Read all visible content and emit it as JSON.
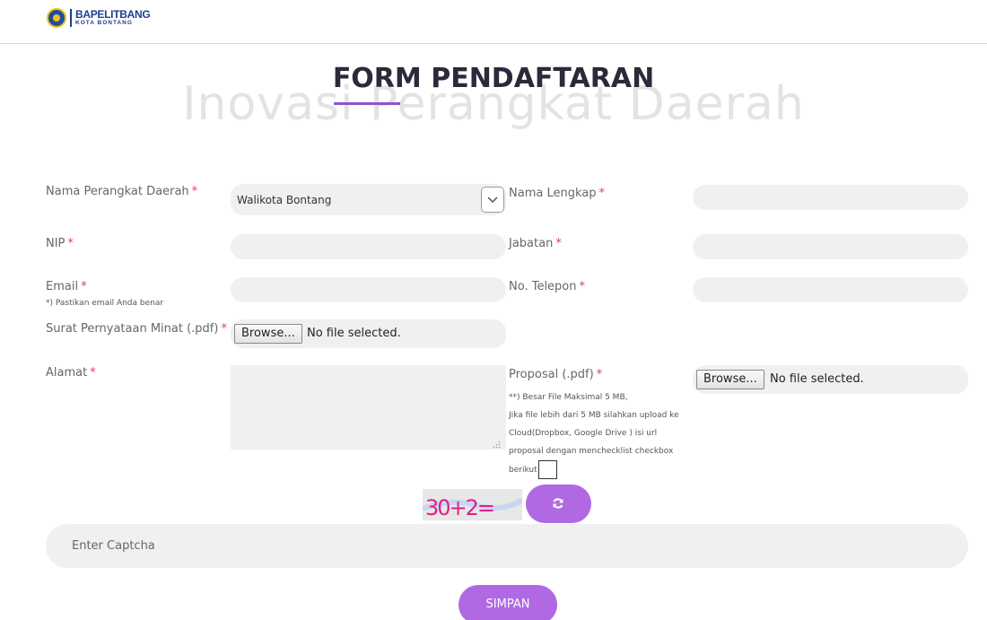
{
  "header": {
    "logo_title": "BAPELITBANG",
    "logo_subtitle": "KOTA BONTANG"
  },
  "page": {
    "title": "FORM PENDAFTARAN",
    "watermark": "Inovasi Perangkat Daerah"
  },
  "form": {
    "required_mark": "*",
    "nama_perangkat_daerah": {
      "label": "Nama Perangkat Daerah",
      "selected": "Walikota Bontang"
    },
    "nama_lengkap": {
      "label": "Nama Lengkap",
      "value": ""
    },
    "nip": {
      "label": "NIP",
      "value": ""
    },
    "jabatan": {
      "label": "Jabatan",
      "value": ""
    },
    "email": {
      "label": "Email",
      "hint": "*) Pastikan email Anda benar",
      "value": ""
    },
    "no_telepon": {
      "label": "No. Telepon",
      "value": ""
    },
    "surat_pernyataan": {
      "label": "Surat Pernyataan Minat (.pdf)",
      "browse_label": "Browse...",
      "status": "No file selected."
    },
    "alamat": {
      "label": "Alamat",
      "value": ""
    },
    "proposal": {
      "label": "Proposal (.pdf)",
      "notes": [
        "**) Besar File Maksimal 5 MB,",
        "Jika file lebih dari 5 MB silahkan upload ke",
        "Cloud(Dropbox, Google Drive ) isi url",
        "proposal dengan menchecklist checkbox",
        "berikut"
      ],
      "checkbox_checked": false,
      "browse_label": "Browse...",
      "status": "No file selected."
    },
    "captcha": {
      "image_text": "30+2=",
      "placeholder": "Enter Captcha",
      "refresh_icon": "refresh-icon"
    },
    "submit_label": "SIMPAN"
  },
  "colors": {
    "accent": "#b069e3",
    "required": "#e04050",
    "field_bg": "#f0f0f0",
    "title": "#2a2a3a"
  }
}
